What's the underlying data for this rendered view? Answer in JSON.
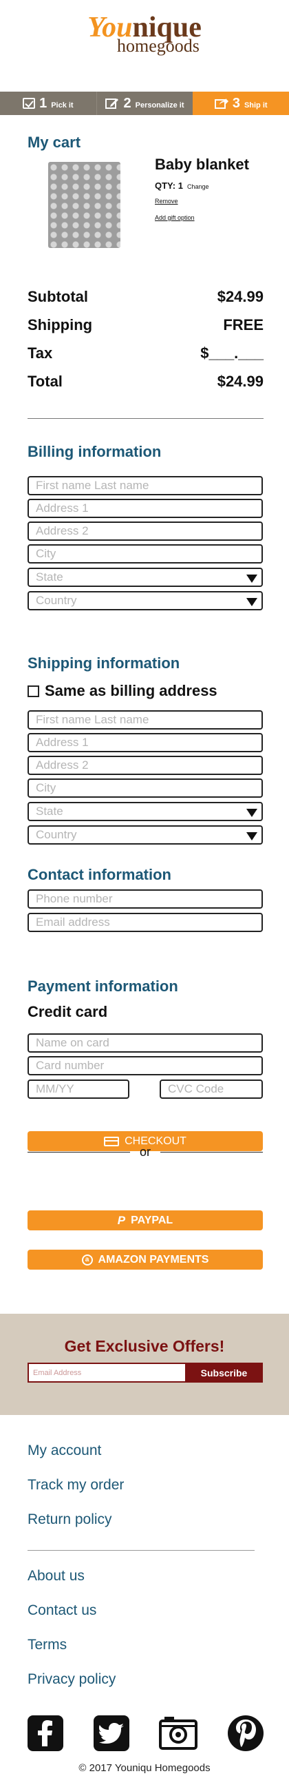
{
  "brand": {
    "logo_part1": "You",
    "logo_part2": "nique",
    "logo_line2": "homegoods"
  },
  "steps": [
    {
      "number": "1",
      "label": "Pick it",
      "icon": "checkbox-icon"
    },
    {
      "number": "2",
      "label": "Personalize it",
      "icon": "edit-icon"
    },
    {
      "number": "3",
      "label": "Ship it",
      "icon": "share-icon"
    }
  ],
  "cart": {
    "title": "My cart",
    "item": {
      "name": "Baby blanket",
      "qty_label": "QTY: 1",
      "change_label": "Change",
      "remove_label": "Remove",
      "gift_label": "Add gift option"
    },
    "totals": [
      {
        "label": "Subtotal",
        "value": "$24.99"
      },
      {
        "label": "Shipping",
        "value": "FREE"
      },
      {
        "label": "Tax",
        "value": "$___.___"
      },
      {
        "label": "Total",
        "value": "$24.99"
      }
    ]
  },
  "billing": {
    "title": "Billing information",
    "fields": [
      "First name Last name",
      "Address 1",
      "Address 2",
      "City",
      "State",
      "Country"
    ]
  },
  "shipping": {
    "title": "Shipping information",
    "same_as_billing": "Same as billing address",
    "fields": [
      "First name Last name",
      "Address 1",
      "Address 2",
      "City",
      "State",
      "Country"
    ]
  },
  "contact": {
    "title": "Contact information",
    "fields": [
      "Phone number",
      "Email address"
    ]
  },
  "payment": {
    "title": "Payment information",
    "credit_card_label": "Credit card",
    "fields": [
      "Name  on card",
      "Card number",
      "MM/YY",
      "CVC Code"
    ]
  },
  "buttons": {
    "checkout": "CHECKOUT",
    "or": "or",
    "paypal": "PAYPAL",
    "amazon": "AMAZON PAYMENTS"
  },
  "offers": {
    "title": "Get Exclusive Offers!",
    "email_placeholder": "Email Address",
    "subscribe": "Subscribe"
  },
  "footer": {
    "links_group1": [
      "My account",
      "Track my order",
      "Return policy"
    ],
    "links_group2": [
      "About us",
      "Contact us",
      "Terms",
      "Privacy policy"
    ],
    "social_icons": [
      "facebook-icon",
      "twitter-icon",
      "instagram-icon",
      "pinterest-icon"
    ],
    "copyright": "© 2017 Youniqu Homegoods"
  },
  "colors": {
    "accent_orange": "#f59423",
    "step_gray": "#7d766b",
    "heading_blue": "#1d5876",
    "offers_red": "#7b1212",
    "offers_bg": "#d5cbbd"
  }
}
